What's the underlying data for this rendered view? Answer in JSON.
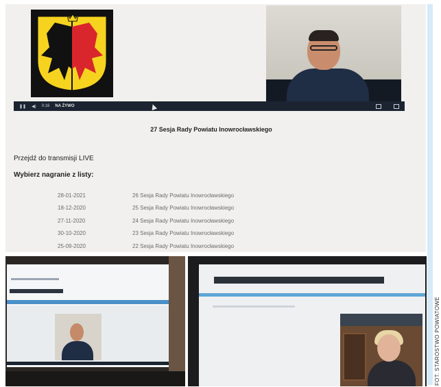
{
  "session_page": {
    "title": "27 Sesja Rady Powiatu Inowrocławskiego",
    "live_link": "Przejdź do transmisji LIVE",
    "choose_label": "Wybierz nagranie z listy:",
    "player": {
      "time": "0:16",
      "live_badge": "NA ŻYWO"
    },
    "recordings": [
      {
        "date": "28-01-2021",
        "name": "26 Sesja Rady Powiatu Inowrocławskiego"
      },
      {
        "date": "18-12-2020",
        "name": "25 Sesja Rady Powiatu Inowrocławskiego"
      },
      {
        "date": "27-11-2020",
        "name": "24 Sesja Rady Powiatu Inowrocławskiego"
      },
      {
        "date": "30-10-2020",
        "name": "23 Sesja Rady Powiatu Inowrocławskiego"
      },
      {
        "date": "25-09-2020",
        "name": "22 Sesja Rady Powiatu Inowrocławskiego"
      }
    ]
  },
  "credit": "FOT. STAROSTWO POWIATOWE",
  "colors": {
    "player_bar": "#1b2430",
    "coat_red": "#d8262c",
    "coat_yellow": "#f6d31f",
    "accent_blue": "#4a90c8"
  }
}
